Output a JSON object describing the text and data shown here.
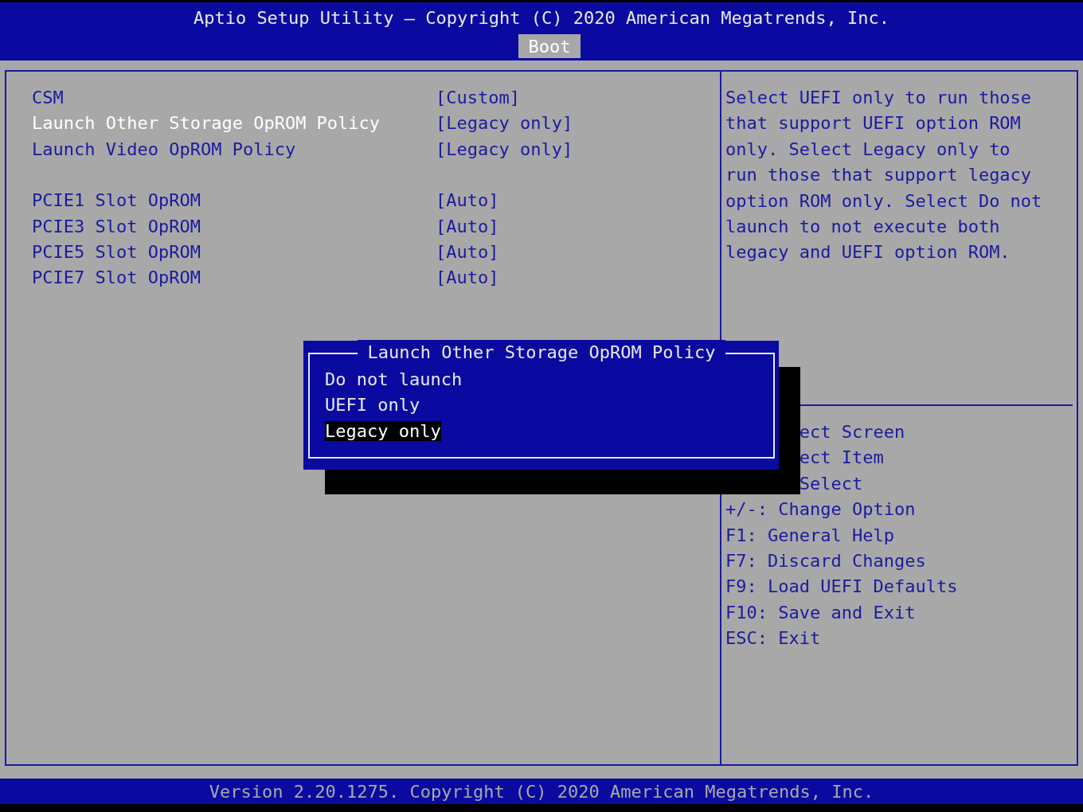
{
  "header": {
    "title": "Aptio Setup Utility – Copyright (C) 2020 American Megatrends, Inc.",
    "tabs": [
      {
        "label": "Boot",
        "selected": true
      }
    ]
  },
  "settings_groups": [
    [
      {
        "label": "CSM",
        "value": "[Custom]",
        "selected": false
      },
      {
        "label": "Launch Other Storage OpROM Policy",
        "value": "[Legacy only]",
        "selected": true
      },
      {
        "label": "Launch Video OpROM Policy",
        "value": "[Legacy only]",
        "selected": false
      }
    ],
    [
      {
        "label": "PCIE1 Slot OpROM",
        "value": "[Auto]",
        "selected": false
      },
      {
        "label": "PCIE3 Slot OpROM",
        "value": "[Auto]",
        "selected": false
      },
      {
        "label": "PCIE5 Slot OpROM",
        "value": "[Auto]",
        "selected": false
      },
      {
        "label": "PCIE7 Slot OpROM",
        "value": "[Auto]",
        "selected": false
      }
    ]
  ],
  "help_text": "Select UEFI only to run those that support UEFI option ROM only. Select Legacy only to run those that support legacy option ROM only. Select Do not launch to not execute both legacy and UEFI option ROM.",
  "key_help": [
    {
      "text": "ect Screen",
      "kind": "partial"
    },
    {
      "text": "ect Item",
      "kind": "partial"
    },
    {
      "text": "Select",
      "kind": "partial"
    },
    {
      "text": "+/-: Change Option",
      "kind": "full"
    },
    {
      "text": "F1: General Help",
      "kind": "full"
    },
    {
      "text": "F7: Discard Changes",
      "kind": "full"
    },
    {
      "text": "F9: Load UEFI Defaults",
      "kind": "full"
    },
    {
      "text": "F10: Save and Exit",
      "kind": "full"
    },
    {
      "text": "ESC: Exit",
      "kind": "full"
    }
  ],
  "popup": {
    "title": "Launch Other Storage OpROM Policy",
    "options": [
      {
        "label": "Do not launch",
        "selected": false
      },
      {
        "label": "UEFI only",
        "selected": false
      },
      {
        "label": "Legacy only",
        "selected": true
      }
    ]
  },
  "status_bar": "Version 2.20.1275. Copyright (C) 2020 American Megatrends, Inc."
}
